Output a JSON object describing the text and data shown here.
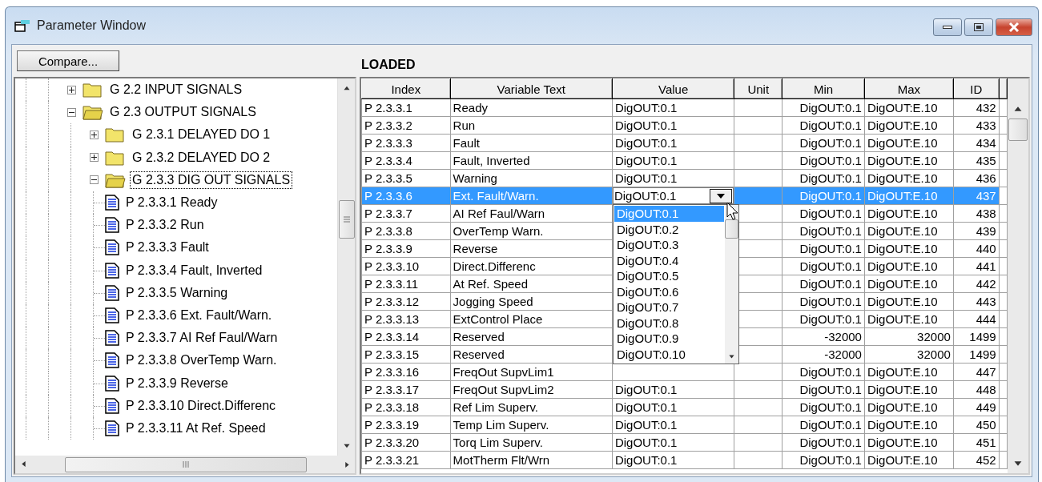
{
  "window": {
    "title": "Parameter Window"
  },
  "toolbar": {
    "compare_button": "Compare...",
    "status": "LOADED"
  },
  "tree": {
    "items": [
      {
        "label": "G 2.2 INPUT SIGNALS",
        "kind": "folder",
        "expanded": false,
        "selected": false
      },
      {
        "label": "G 2.3 OUTPUT SIGNALS",
        "kind": "folder",
        "expanded": true,
        "selected": false,
        "children": [
          {
            "label": "G 2.3.1 DELAYED DO 1",
            "kind": "folder",
            "expanded": false,
            "selected": false
          },
          {
            "label": "G 2.3.2 DELAYED DO 2",
            "kind": "folder",
            "expanded": false,
            "selected": false
          },
          {
            "label": "G 2.3.3 DIG OUT SIGNALS",
            "kind": "folder",
            "expanded": true,
            "selected": true,
            "children": [
              {
                "label": "P 2.3.3.1 Ready",
                "kind": "param",
                "selected": false
              },
              {
                "label": "P 2.3.3.2 Run",
                "kind": "param",
                "selected": false
              },
              {
                "label": "P 2.3.3.3 Fault",
                "kind": "param",
                "selected": false
              },
              {
                "label": "P 2.3.3.4 Fault, Inverted",
                "kind": "param",
                "selected": false
              },
              {
                "label": "P 2.3.3.5 Warning",
                "kind": "param",
                "selected": false
              },
              {
                "label": "P 2.3.3.6 Ext. Fault/Warn.",
                "kind": "param",
                "selected": false
              },
              {
                "label": "P 2.3.3.7 AI Ref Faul/Warn",
                "kind": "param",
                "selected": false
              },
              {
                "label": "P 2.3.3.8 OverTemp Warn.",
                "kind": "param",
                "selected": false
              },
              {
                "label": "P 2.3.3.9 Reverse",
                "kind": "param",
                "selected": false
              },
              {
                "label": "P 2.3.3.10 Direct.Differenc",
                "kind": "param",
                "selected": false
              },
              {
                "label": "P 2.3.3.11 At Ref. Speed",
                "kind": "param",
                "selected": false
              }
            ]
          }
        ]
      }
    ]
  },
  "table": {
    "columns": [
      "Index",
      "Variable Text",
      "Value",
      "Unit",
      "Min",
      "Max",
      "ID"
    ],
    "rows": [
      {
        "index": "P 2.3.3.1",
        "text": "Ready",
        "value": "DigOUT:0.1",
        "min": "DigOUT:0.1",
        "max": "DigOUT:E.10",
        "id": "432",
        "selected": false
      },
      {
        "index": "P 2.3.3.2",
        "text": "Run",
        "value": "DigOUT:0.1",
        "min": "DigOUT:0.1",
        "max": "DigOUT:E.10",
        "id": "433",
        "selected": false
      },
      {
        "index": "P 2.3.3.3",
        "text": "Fault",
        "value": "DigOUT:0.1",
        "min": "DigOUT:0.1",
        "max": "DigOUT:E.10",
        "id": "434",
        "selected": false
      },
      {
        "index": "P 2.3.3.4",
        "text": "Fault, Inverted",
        "value": "DigOUT:0.1",
        "min": "DigOUT:0.1",
        "max": "DigOUT:E.10",
        "id": "435",
        "selected": false
      },
      {
        "index": "P 2.3.3.5",
        "text": "Warning",
        "value": "DigOUT:0.1",
        "min": "DigOUT:0.1",
        "max": "DigOUT:E.10",
        "id": "436",
        "selected": false
      },
      {
        "index": "P 2.3.3.6",
        "text": "Ext. Fault/Warn.",
        "value": "DigOUT:0.1",
        "min": "DigOUT:0.1",
        "max": "DigOUT:E.10",
        "id": "437",
        "selected": true,
        "dropdown": [
          {
            "label": "DigOUT:0.1",
            "selected": true
          },
          {
            "label": "DigOUT:0.2",
            "selected": false
          },
          {
            "label": "DigOUT:0.3",
            "selected": false
          },
          {
            "label": "DigOUT:0.4",
            "selected": false
          },
          {
            "label": "DigOUT:0.5",
            "selected": false
          },
          {
            "label": "DigOUT:0.6",
            "selected": false
          },
          {
            "label": "DigOUT:0.7",
            "selected": false
          },
          {
            "label": "DigOUT:0.8",
            "selected": false
          },
          {
            "label": "DigOUT:0.9",
            "selected": false
          },
          {
            "label": "DigOUT:0.10",
            "selected": false
          }
        ]
      },
      {
        "index": "P 2.3.3.7",
        "text": "AI Ref Faul/Warn",
        "min": "DigOUT:0.1",
        "max": "DigOUT:E.10",
        "id": "438",
        "selected": false
      },
      {
        "index": "P 2.3.3.8",
        "text": "OverTemp Warn.",
        "min": "DigOUT:0.1",
        "max": "DigOUT:E.10",
        "id": "439",
        "selected": false
      },
      {
        "index": "P 2.3.3.9",
        "text": "Reverse",
        "min": "DigOUT:0.1",
        "max": "DigOUT:E.10",
        "id": "440",
        "selected": false
      },
      {
        "index": "P 2.3.3.10",
        "text": "Direct.Differenc",
        "min": "DigOUT:0.1",
        "max": "DigOUT:E.10",
        "id": "441",
        "selected": false
      },
      {
        "index": "P 2.3.3.11",
        "text": "At Ref. Speed",
        "min": "DigOUT:0.1",
        "max": "DigOUT:E.10",
        "id": "442",
        "selected": false
      },
      {
        "index": "P 2.3.3.12",
        "text": "Jogging Speed",
        "min": "DigOUT:0.1",
        "max": "DigOUT:E.10",
        "id": "443",
        "selected": false
      },
      {
        "index": "P 2.3.3.13",
        "text": "ExtControl Place",
        "min": "DigOUT:0.1",
        "max": "DigOUT:E.10",
        "id": "444",
        "selected": false
      },
      {
        "index": "P 2.3.3.14",
        "text": "Reserved",
        "min": "-32000",
        "max": "32000",
        "id": "1499",
        "selected": false
      },
      {
        "index": "P 2.3.3.15",
        "text": "Reserved",
        "min": "-32000",
        "max": "32000",
        "id": "1499",
        "selected": false
      },
      {
        "index": "P 2.3.3.16",
        "text": "FreqOut SupvLim1",
        "min": "DigOUT:0.1",
        "max": "DigOUT:E.10",
        "id": "447",
        "selected": false
      },
      {
        "index": "P 2.3.3.17",
        "text": "FreqOut SupvLim2",
        "value": "DigOUT:0.1",
        "min": "DigOUT:0.1",
        "max": "DigOUT:E.10",
        "id": "448",
        "selected": false
      },
      {
        "index": "P 2.3.3.18",
        "text": "Ref Lim Superv.",
        "value": "DigOUT:0.1",
        "min": "DigOUT:0.1",
        "max": "DigOUT:E.10",
        "id": "449",
        "selected": false
      },
      {
        "index": "P 2.3.3.19",
        "text": "Temp Lim Superv.",
        "value": "DigOUT:0.1",
        "min": "DigOUT:0.1",
        "max": "DigOUT:E.10",
        "id": "450",
        "selected": false
      },
      {
        "index": "P 2.3.3.20",
        "text": "Torq Lim Superv.",
        "value": "DigOUT:0.1",
        "min": "DigOUT:0.1",
        "max": "DigOUT:E.10",
        "id": "451",
        "selected": false
      },
      {
        "index": "P 2.3.3.21",
        "text": "MotTherm Flt/Wrn",
        "value": "DigOUT:0.1",
        "min": "DigOUT:0.1",
        "max": "DigOUT:E.10",
        "id": "452",
        "selected": false
      }
    ]
  }
}
